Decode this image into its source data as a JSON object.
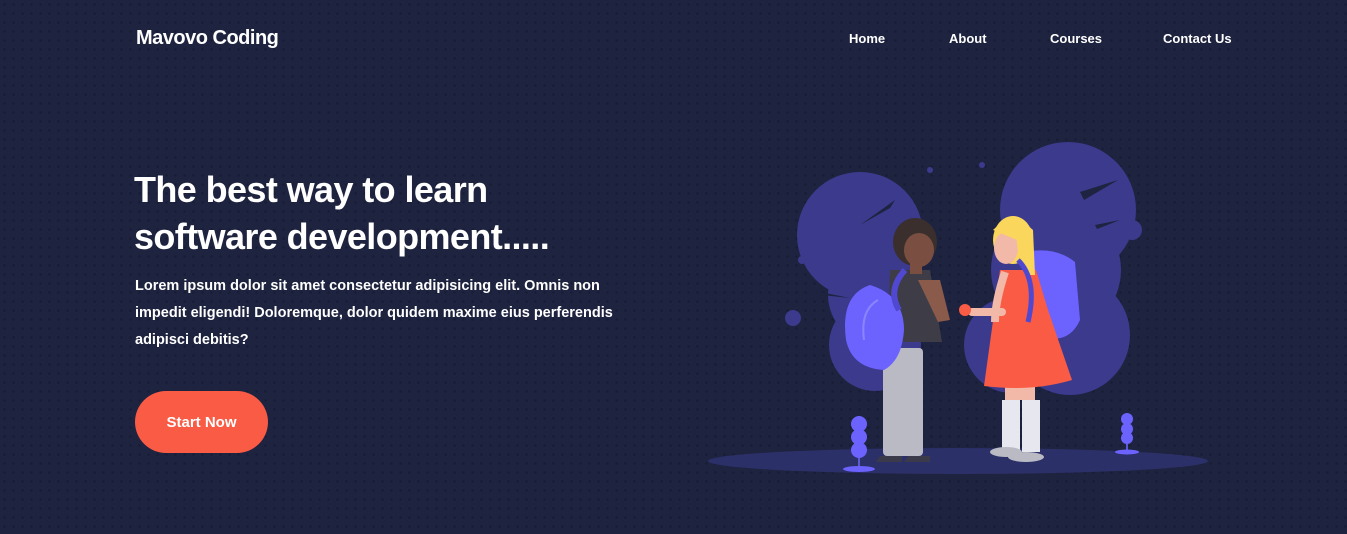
{
  "header": {
    "brand": "Mavovo Coding",
    "nav": [
      {
        "label": "Home"
      },
      {
        "label": "About"
      },
      {
        "label": "Courses"
      },
      {
        "label": "Contact Us"
      }
    ]
  },
  "hero": {
    "title_line1": "The best way to learn",
    "title_line2": "software development.....",
    "description": "Lorem ipsum dolor sit amet consectetur adipisicing elit. Omnis non impedit eligendi! Doloremque, dolor quidem maxime eius perferendis adipisci debitis?",
    "cta_label": "Start Now"
  },
  "colors": {
    "background": "#1e2340",
    "accent": "#f95b44",
    "illustration_purple": "#6c63ff"
  }
}
